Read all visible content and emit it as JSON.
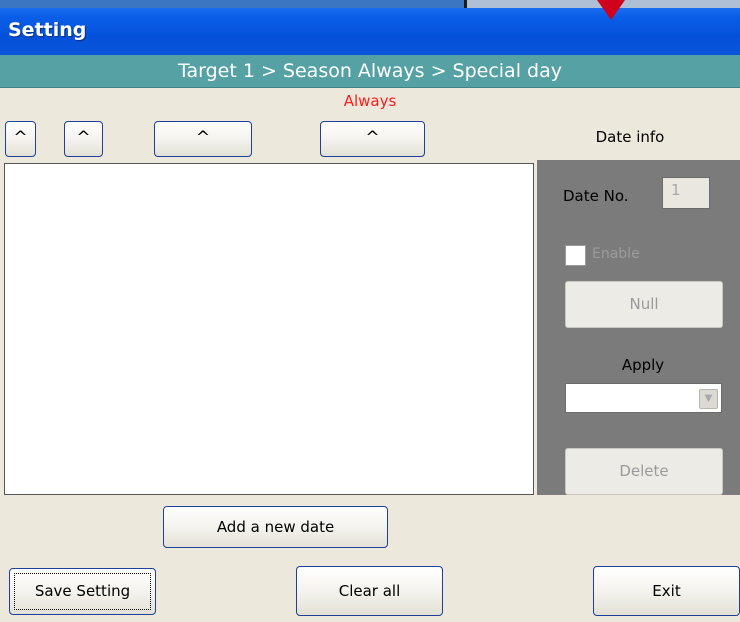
{
  "window": {
    "title": "Setting"
  },
  "breadcrumb": "Target 1 > Season Always > Special day",
  "season_label": "Always",
  "caret_buttons": [
    "^",
    "^",
    "^",
    "^"
  ],
  "date_info": {
    "heading": "Date info",
    "date_no_label": "Date No.",
    "date_no_value": "1",
    "enable_label": "Enable",
    "enable_checked": false,
    "null_button": "Null",
    "apply_label": "Apply",
    "apply_value": "",
    "delete_button": "Delete"
  },
  "buttons": {
    "add_date": "Add a new date",
    "save": "Save Setting",
    "clear": "Clear all",
    "exit": "Exit"
  },
  "colors": {
    "title_bar": "#0450d8",
    "breadcrumb_bar": "#56a1a3",
    "season_label": "#ff1a1a",
    "panel": "#7b7b7b",
    "marker": "#d0021b"
  }
}
